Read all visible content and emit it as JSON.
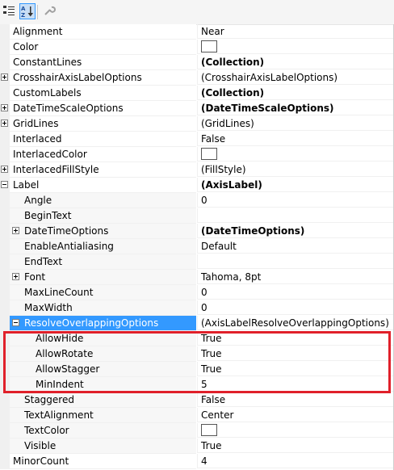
{
  "toolbar": {
    "buttons": [
      {
        "name": "categorized-icon",
        "active": false
      },
      {
        "name": "alphabetical-icon",
        "active": true
      },
      {
        "name": "property-pages-icon",
        "active": false
      }
    ]
  },
  "colors": {
    "selection": "#3399ff",
    "highlight_box": "#e0202a"
  },
  "properties": [
    {
      "name": "Alignment",
      "value": "Near",
      "level": 0
    },
    {
      "name": "Color",
      "value": "",
      "swatch": true,
      "level": 0
    },
    {
      "name": "ConstantLines",
      "value": "(Collection)",
      "bold": true,
      "level": 0
    },
    {
      "name": "CrosshairAxisLabelOptions",
      "value": "(CrosshairAxisLabelOptions)",
      "expander": "plus",
      "level": 0
    },
    {
      "name": "CustomLabels",
      "value": "(Collection)",
      "bold": true,
      "level": 0
    },
    {
      "name": "DateTimeScaleOptions",
      "value": "(DateTimeScaleOptions)",
      "bold": true,
      "expander": "plus",
      "level": 0
    },
    {
      "name": "GridLines",
      "value": "(GridLines)",
      "expander": "plus",
      "level": 0
    },
    {
      "name": "Interlaced",
      "value": "False",
      "level": 0
    },
    {
      "name": "InterlacedColor",
      "value": "",
      "swatch": true,
      "level": 0
    },
    {
      "name": "InterlacedFillStyle",
      "value": "(FillStyle)",
      "expander": "plus",
      "level": 0
    },
    {
      "name": "Label",
      "value": "(AxisLabel)",
      "bold": true,
      "expander": "minus",
      "level": 0
    },
    {
      "name": "Angle",
      "value": "0",
      "level": 1
    },
    {
      "name": "BeginText",
      "value": "",
      "level": 1
    },
    {
      "name": "DateTimeOptions",
      "value": "(DateTimeOptions)",
      "bold": true,
      "expander": "plus",
      "level": 1
    },
    {
      "name": "EnableAntialiasing",
      "value": "Default",
      "level": 1
    },
    {
      "name": "EndText",
      "value": "",
      "level": 1
    },
    {
      "name": "Font",
      "value": "Tahoma, 8pt",
      "expander": "plus",
      "level": 1
    },
    {
      "name": "MaxLineCount",
      "value": "0",
      "level": 1
    },
    {
      "name": "MaxWidth",
      "value": "0",
      "level": 1
    },
    {
      "name": "ResolveOverlappingOptions",
      "value": "(AxisLabelResolveOverlappingOptions)",
      "expander": "minus",
      "selected": true,
      "level": 1
    },
    {
      "name": "AllowHide",
      "value": "True",
      "level": 2
    },
    {
      "name": "AllowRotate",
      "value": "True",
      "level": 2
    },
    {
      "name": "AllowStagger",
      "value": "True",
      "level": 2
    },
    {
      "name": "MinIndent",
      "value": "5",
      "level": 2
    },
    {
      "name": "Staggered",
      "value": "False",
      "level": 1
    },
    {
      "name": "TextAlignment",
      "value": "Center",
      "level": 1
    },
    {
      "name": "TextColor",
      "value": "",
      "swatch": true,
      "level": 1
    },
    {
      "name": "Visible",
      "value": "True",
      "level": 1
    },
    {
      "name": "MinorCount",
      "value": "4",
      "level": 0
    }
  ]
}
